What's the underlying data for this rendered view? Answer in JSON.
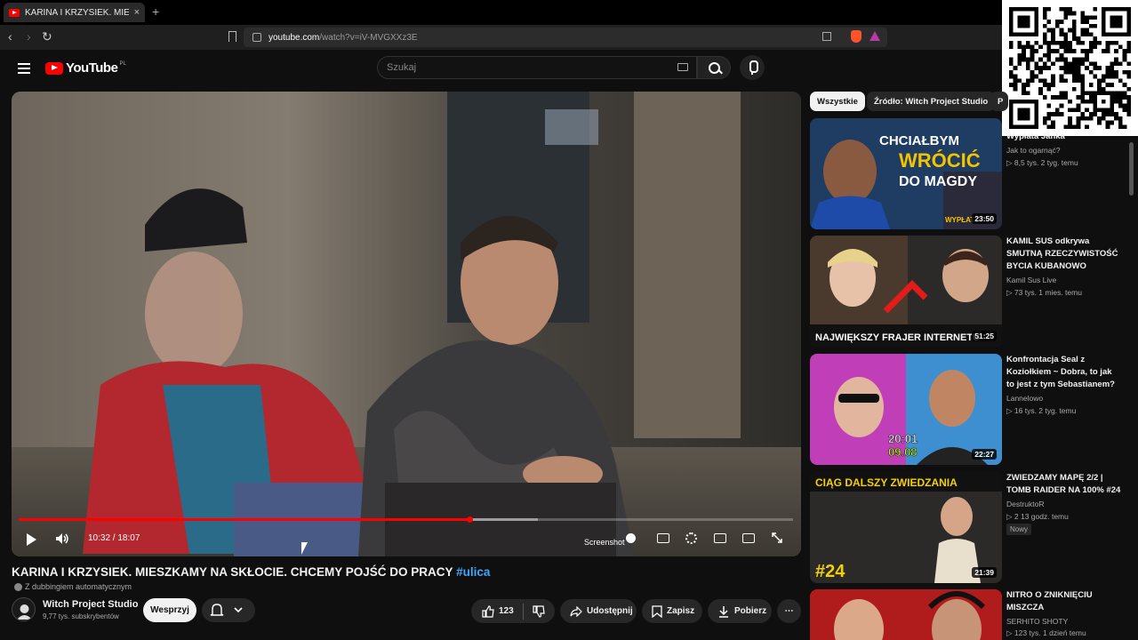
{
  "browser": {
    "tab_title": "KARINA I KRZYSIEK. MIESZKAMY",
    "tab_close": "×",
    "new_tab": "+",
    "url_host": "youtube.com",
    "url_path": "/watch?v=iV-MVGXXz3E"
  },
  "header": {
    "logo_text": "YouTube",
    "region": "PL",
    "search_placeholder": "Szukaj"
  },
  "player": {
    "time": "10:32 / 18:07",
    "progress_fraction": 0.582,
    "buffered_fraction": 0.67,
    "screenshot_label": "Screenshot"
  },
  "video": {
    "title": "KARINA I KRZYSIEK. MIESZKAMY NA SKŁOCIE. CHCEMY POJŚĆ DO PRACY",
    "hashtag": "#ulica",
    "dubbing": "Z dubbingiem automatycznym",
    "channel_name": "Witch Project Studio",
    "channel_subs": "9,77 tys. subskrybentów",
    "support_label": "Wesprzyj",
    "like_count": "123",
    "share_label": "Udostępnij",
    "save_label": "Zapisz",
    "download_label": "Pobierz",
    "more_label": "⋯"
  },
  "sidebar": {
    "chips": [
      "Wszystkie",
      "Źródło: Witch Project Studio",
      "P"
    ],
    "items": [
      {
        "title": "Wypłata Janka",
        "channel": "Jak to ogarnąć?",
        "meta": "▷ 8,5 tys.   2 tyg. temu",
        "duration": "23:50",
        "thumb_text1": "CHCIAŁBYM",
        "thumb_text2": "WRÓCIĆ",
        "thumb_text3": "DO MAGDY",
        "thumb_badge": "WYPŁAT"
      },
      {
        "title": "KAMIL SUS odkrywa SMUTNĄ RZECZYWISTOŚĆ BYCIA KUBANOWO",
        "channel": "Kamil Sus Live",
        "meta": "▷ 73 tys.   1 mies. temu",
        "duration": "51:25",
        "thumb_text1": "NAJWIĘKSZY FRAJER INTERNETU"
      },
      {
        "title": "Konfrontacja Seal z Koziołkiem ~ Dobra, to jak to jest z tym Sebastianem?",
        "channel": "Lannelowo",
        "meta": "▷ 16 tys.   2 tyg. temu",
        "duration": "22:27",
        "thumb_text1": "20:01",
        "thumb_text2": "09.08"
      },
      {
        "title": "ZWIEDZAMY MAPĘ 2/2 | TOMB RAIDER NA 100% #24",
        "channel": "DestruktoR",
        "meta": "▷ 2   13 godz. temu",
        "duration": "21:39",
        "badge": "Nowy",
        "thumb_text1": "CIĄG DALSZY ZWIEDZANIA",
        "thumb_text2": "#24"
      },
      {
        "title": "NITRO O ZNIKNIĘCIU MISZCZA",
        "channel": "SERHITO SHOTY",
        "meta": "▷ 123 tys.   1 dzień temu"
      }
    ]
  },
  "colors": {
    "background": "#0f0f0f",
    "accent_red": "#ff0000",
    "hashtag_blue": "#3ea6ff",
    "chip_active": "#f1f1f1"
  },
  "icons": [
    "menu-icon",
    "search-icon",
    "mic-icon",
    "play-icon",
    "volume-icon",
    "settings-icon",
    "fullscreen-icon",
    "like-icon",
    "dislike-icon",
    "share-icon",
    "save-icon",
    "download-icon",
    "bell-icon",
    "qr-code"
  ]
}
